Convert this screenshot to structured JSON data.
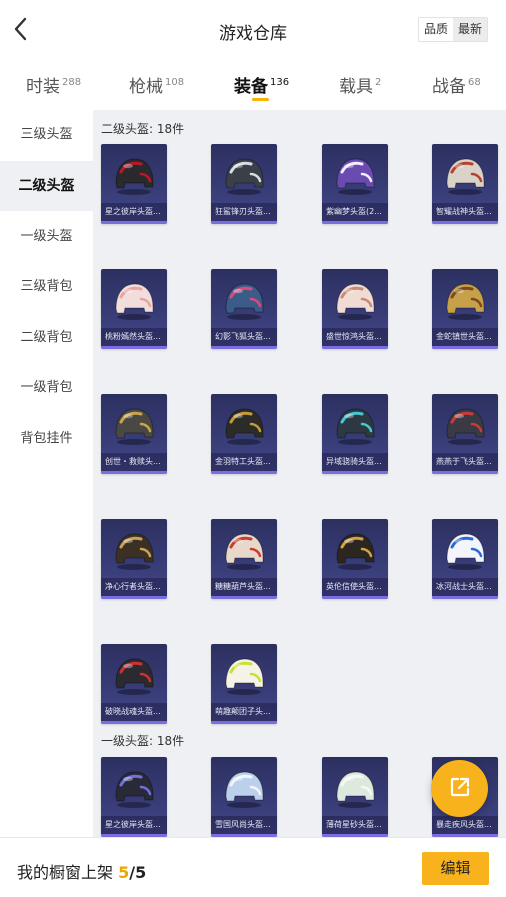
{
  "header": {
    "title": "游戏仓库",
    "sort_quality": "品质",
    "sort_newest": "最新",
    "back_icon": "chevron-left-icon"
  },
  "tabs": [
    {
      "label": "时装",
      "count": "288"
    },
    {
      "label": "枪械",
      "count": "108"
    },
    {
      "label": "装备",
      "count": "136",
      "active": true
    },
    {
      "label": "载具",
      "count": "2"
    },
    {
      "label": "战备",
      "count": "68"
    }
  ],
  "sidebar": {
    "items": [
      {
        "label": "三级头盔"
      },
      {
        "label": "二级头盔",
        "active": true
      },
      {
        "label": "一级头盔"
      },
      {
        "label": "三级背包"
      },
      {
        "label": "二级背包"
      },
      {
        "label": "一级背包"
      },
      {
        "label": "背包挂件"
      }
    ]
  },
  "sections": [
    {
      "title": "二级头盔: 18件",
      "items": [
        {
          "name": "星之彼岸头盔...",
          "color": "#2a2a2e",
          "accent": "#c0162a"
        },
        {
          "name": "狂鲨锋刃头盔...",
          "color": "#3a3f48",
          "accent": "#d8dde6"
        },
        {
          "name": "紫幽梦头盔(2...",
          "color": "#6a4bb0",
          "accent": "#f1ecff"
        },
        {
          "name": "智耀战神头盔...",
          "color": "#d9d2c8",
          "accent": "#b8412c"
        },
        {
          "name": "桃粉嫣然头盔...",
          "color": "#f1dedc",
          "accent": "#e9a4a0"
        },
        {
          "name": "幻影飞狐头盔...",
          "color": "#3b5b88",
          "accent": "#e0487e"
        },
        {
          "name": "盛世惊鸿头盔...",
          "color": "#f0dcd2",
          "accent": "#c58a7a"
        },
        {
          "name": "金蛇镇世头盔...",
          "color": "#c7a04a",
          "accent": "#7a4a1e"
        },
        {
          "name": "创世・救赎头...",
          "color": "#4a4843",
          "accent": "#c9a64c"
        },
        {
          "name": "金羽特工头盔...",
          "color": "#2b2b27",
          "accent": "#c49a3a"
        },
        {
          "name": "异域骁骑头盔...",
          "color": "#2c3842",
          "accent": "#49c6d6"
        },
        {
          "name": "燕燕于飞头盔...",
          "color": "#3a3a44",
          "accent": "#c93a3a"
        },
        {
          "name": "净心行者头盔...",
          "color": "#3a3024",
          "accent": "#c9a256"
        },
        {
          "name": "糖糖葫芦头盔...",
          "color": "#e8d8cc",
          "accent": "#c83c2a"
        },
        {
          "name": "英伦信使头盔...",
          "color": "#2c2620",
          "accent": "#d0a24a"
        },
        {
          "name": "冰河战士头盔...",
          "color": "#f4f5fa",
          "accent": "#2a6ad8"
        },
        {
          "name": "破晓战魂头盔...",
          "color": "#2a2a30",
          "accent": "#d03030"
        },
        {
          "name": "萌趣颠团子头...",
          "color": "#f5f3e8",
          "accent": "#c8e032"
        }
      ]
    },
    {
      "title": "一级头盔: 18件",
      "items": [
        {
          "name": "星之彼岸头盔...",
          "color": "#2a2a36",
          "accent": "#7070e0"
        },
        {
          "name": "雪国风尚头盔...",
          "color": "#bcd0ec",
          "accent": "#f2f5fb"
        },
        {
          "name": "薄荷星砂头盔...",
          "color": "#dde9dd",
          "accent": "#f4f8f4"
        },
        {
          "name": "暴走疾风头盔...",
          "color": "#3a3a46",
          "accent": "#e26a2a"
        }
      ]
    }
  ],
  "fab": {
    "icon": "share-external-icon"
  },
  "bottom": {
    "shelf_label": "我的橱窗上架",
    "shelf_count": "5",
    "shelf_sep": "/",
    "shelf_total": "5",
    "edit_label": "编辑"
  }
}
